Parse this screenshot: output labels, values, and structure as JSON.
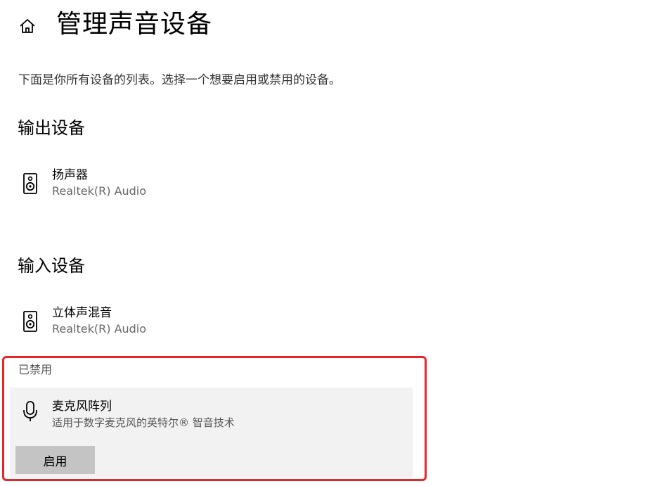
{
  "header": {
    "home_icon": "home-icon",
    "title": "管理声音设备"
  },
  "description": "下面是你所有设备的列表。选择一个想要启用或禁用的设备。",
  "output_section": {
    "heading": "输出设备",
    "devices": [
      {
        "name": "扬声器",
        "subtitle": "Realtek(R) Audio",
        "icon": "speaker-icon"
      }
    ]
  },
  "input_section": {
    "heading": "输入设备",
    "devices": [
      {
        "name": "立体声混音",
        "subtitle": "Realtek(R) Audio",
        "icon": "speaker-icon"
      }
    ]
  },
  "disabled_section": {
    "label": "已禁用",
    "device": {
      "name": "麦克风阵列",
      "subtitle": "适用于数字麦克风的英特尔® 智音技术",
      "icon": "microphone-icon"
    },
    "enable_button_label": "启用"
  },
  "colors": {
    "highlight_border": "#e8262a",
    "card_background": "#f2f2f2",
    "button_background": "#c4c4c4"
  }
}
